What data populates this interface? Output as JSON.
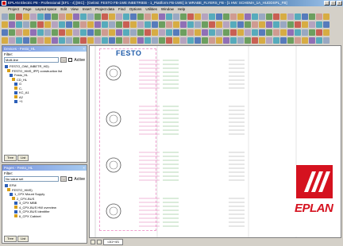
{
  "window": {
    "title": "EPLAN Electric P8 - Professional [EF1 - 4] [IEC] - [Gelöst: FESTO FB-1WE INBETRIEB - 1_Piattform FB-1WE] in WRABE_FLYERS_FB - [1 HW: SCHEMA_1A_HUDDSPL_FB]",
    "minimize": "_",
    "maximize": "□",
    "close": "×"
  },
  "menubar": [
    "Project",
    "Page",
    "Layout space",
    "Edit",
    "View",
    "Insert",
    "Project data",
    "Find",
    "Options",
    "Utilities",
    "Window",
    "Help"
  ],
  "toolbar_colors": [
    "#2c5fb8",
    "#4a8f3c",
    "#c53a2c",
    "#d8a017",
    "#7a4fb0",
    "#2c9fb8"
  ],
  "devices_panel": {
    "title": "Devices - Festo_HL",
    "filter_label": "Filter:",
    "filter_value": "Multi-line",
    "filter_btn": "...",
    "active_label": "Active",
    "tree": [
      "FESTO_OWI_INBETR_HD)",
      "FESTO_HMS_IPP) construction list",
      "Festo_HL",
      "CD_HL",
      "G",
      "C-",
      "KC_A1",
      "A2",
      "+1"
    ],
    "tab_tree": "Tree",
    "tab_list": "List"
  },
  "pages_panel": {
    "title": "Pages - Festo_HL",
    "filter_label": "Filter:",
    "filter_value": "No value set",
    "filter_btn": "...",
    "active_label": "Active",
    "tree": [
      "EFM",
      "FESTO_HMS)",
      "1_CPX Mount Supply",
      "2_CPX-BUS",
      "3_CPX MBB",
      "4_CPX-BUS HW overview",
      "5_CPX-BUS Identifier",
      "6_CPX Cabinet"
    ],
    "tab_tree": "Tree",
    "tab_list": "List"
  },
  "canvas": {
    "festo_logo": "FESTO",
    "eplan_logo": "EPLAN",
    "sheet_tab": "=A1+4/1"
  }
}
